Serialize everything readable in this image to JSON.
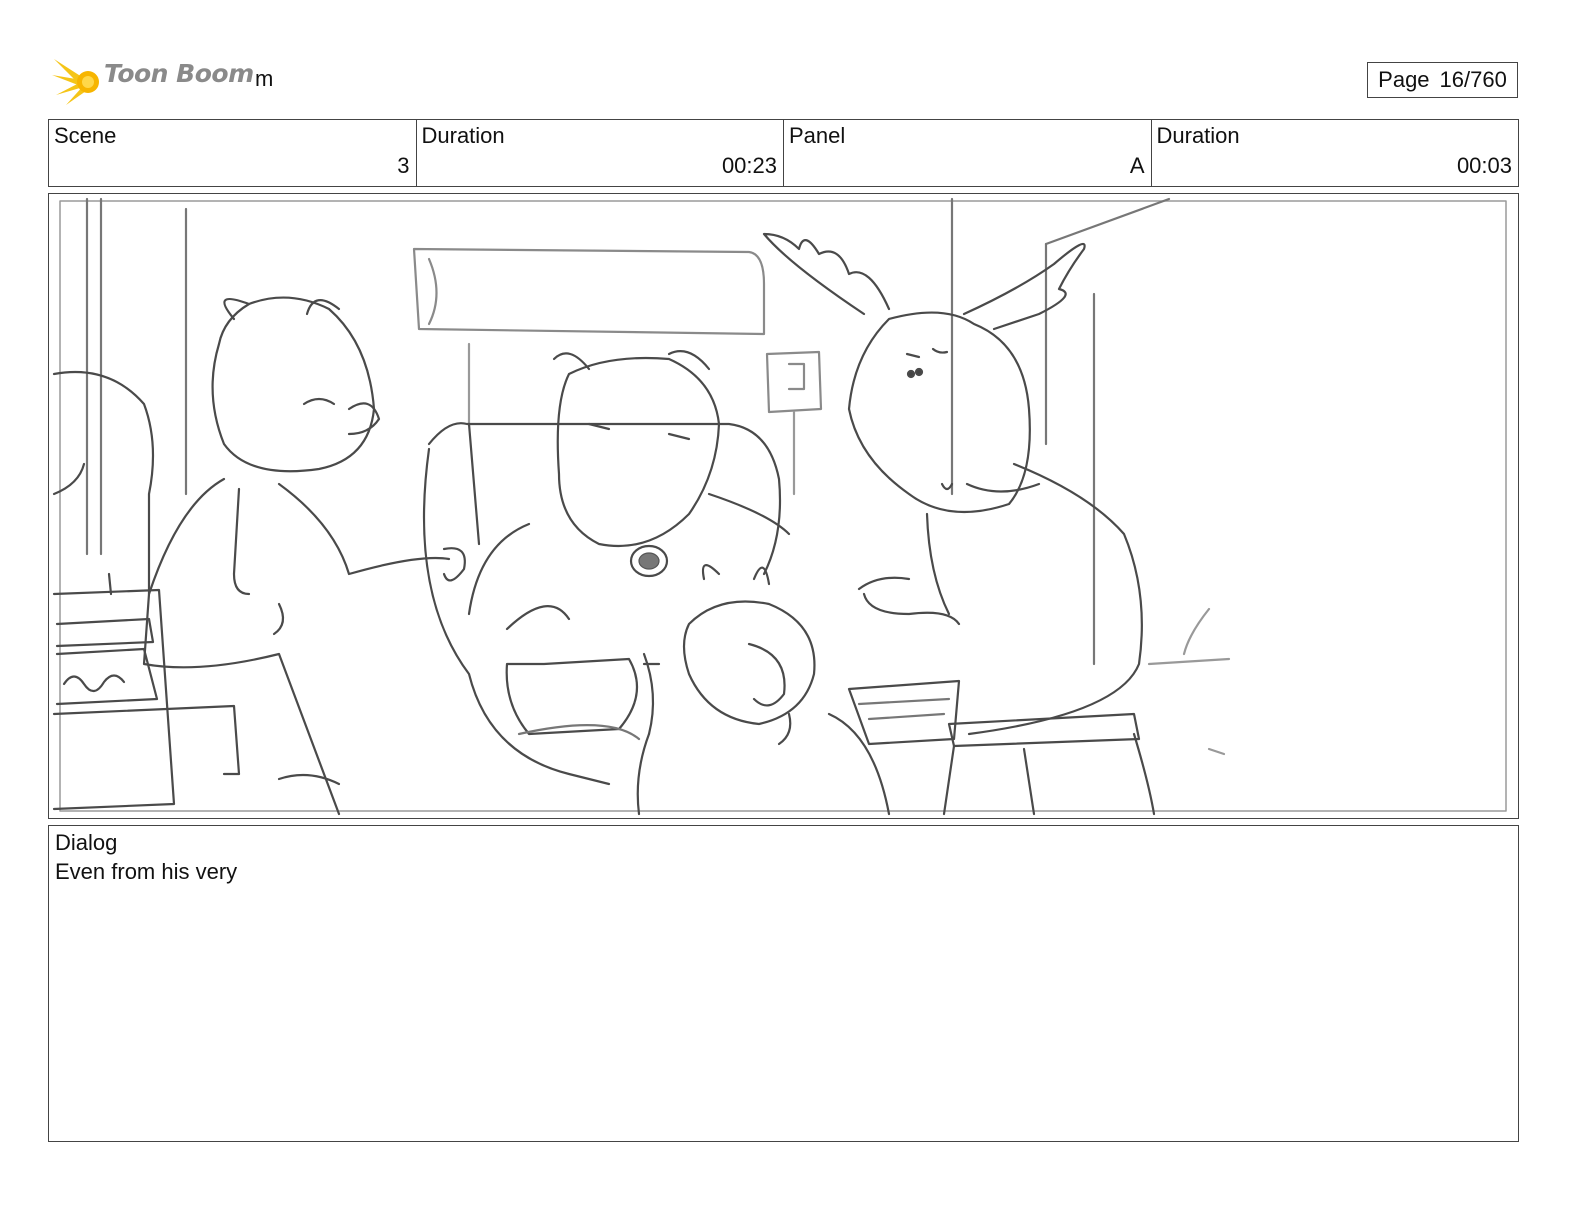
{
  "header": {
    "logo_text": "Toon Boom",
    "project_name": "m",
    "page_label": "Page",
    "page_number": "16/760"
  },
  "info": {
    "scene_label": "Scene",
    "scene_value": "3",
    "scene_duration_label": "Duration",
    "scene_duration_value": "00:23",
    "panel_label": "Panel",
    "panel_value": "A",
    "panel_duration_label": "Duration",
    "panel_duration_value": "00:03"
  },
  "dialog": {
    "label": "Dialog",
    "text": "Even from his very"
  },
  "colors": {
    "logo_star": "#f5c518",
    "logo_text": "#8a8a8a",
    "sketch_line": "#4a4a4a",
    "border": "#444444"
  }
}
